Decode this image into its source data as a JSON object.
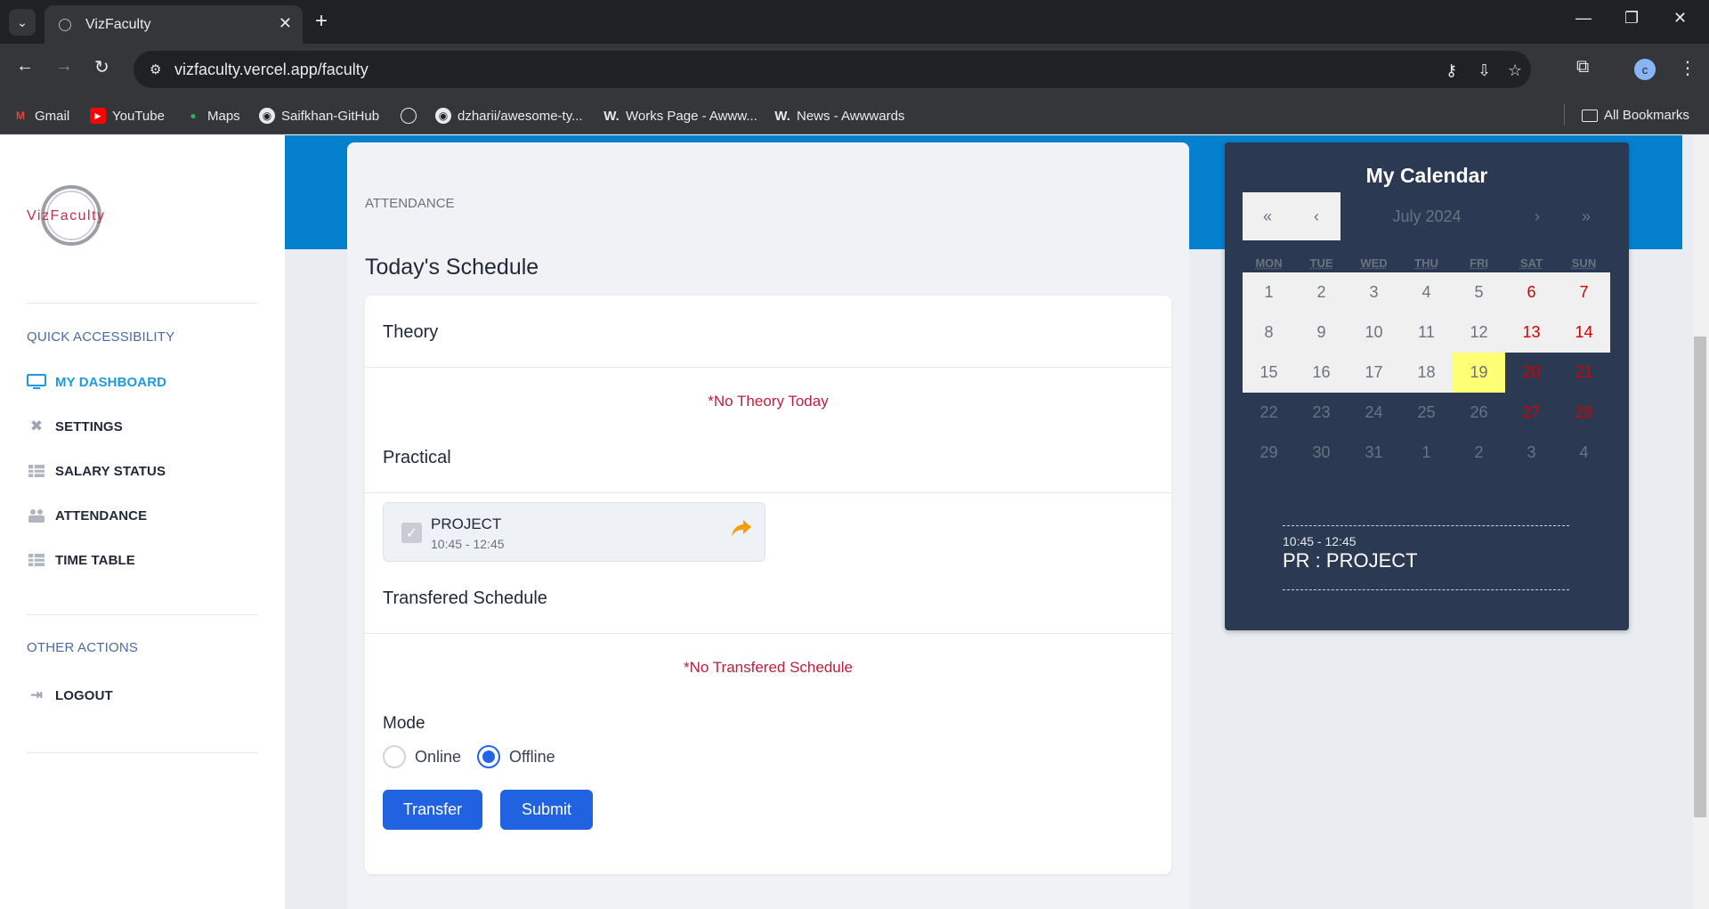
{
  "browser": {
    "tab_title": "VizFaculty",
    "url": "vizfaculty.vercel.app/faculty",
    "bookmarks": [
      {
        "label": "Gmail",
        "icon": "gmail-icon"
      },
      {
        "label": "YouTube",
        "icon": "youtube-icon"
      },
      {
        "label": "Maps",
        "icon": "maps-icon"
      },
      {
        "label": "Saifkhan-GitHub",
        "icon": "github-icon"
      },
      {
        "label": "",
        "icon": "globe-icon"
      },
      {
        "label": "dzharii/awesome-ty...",
        "icon": "github-icon"
      },
      {
        "label": "Works Page - Awww...",
        "icon": "awwwards-icon"
      },
      {
        "label": "News - Awwwards",
        "icon": "awwwards-icon"
      }
    ],
    "all_bookmarks": "All Bookmarks",
    "avatar_letter": "c"
  },
  "sidebar": {
    "logo_text": "VizFaculty",
    "quick_title": "QUICK ACCESSIBILITY",
    "items": [
      {
        "label": "MY DASHBOARD",
        "icon": "monitor-icon",
        "active": true
      },
      {
        "label": "SETTINGS",
        "icon": "tools-icon"
      },
      {
        "label": "SALARY STATUS",
        "icon": "table-icon"
      },
      {
        "label": "ATTENDANCE",
        "icon": "people-icon"
      },
      {
        "label": "TIME TABLE",
        "icon": "table-icon"
      }
    ],
    "other_title": "OTHER ACTIONS",
    "logout": "LOGOUT"
  },
  "main": {
    "label": "ATTENDANCE",
    "heading": "Today's Schedule",
    "theory_title": "Theory",
    "no_theory": "*No Theory Today",
    "practical_title": "Practical",
    "practical_items": [
      {
        "name": "PROJECT",
        "time": "10:45 - 12:45"
      }
    ],
    "transfered_title": "Transfered Schedule",
    "no_transfered": "*No Transfered Schedule",
    "mode_label": "Mode",
    "mode_options": [
      "Online",
      "Offline"
    ],
    "mode_selected": "Offline",
    "transfer_btn": "Transfer",
    "submit_btn": "Submit"
  },
  "calendar": {
    "title": "My Calendar",
    "month": "July 2024",
    "nav": [
      "«",
      "‹",
      "›",
      "»"
    ],
    "weekdays": [
      "MON",
      "TUE",
      "WED",
      "THU",
      "FRI",
      "SAT",
      "SUN"
    ],
    "weeks": [
      [
        "1",
        "2",
        "3",
        "4",
        "5",
        "6",
        "7"
      ],
      [
        "8",
        "9",
        "10",
        "11",
        "12",
        "13",
        "14"
      ],
      [
        "15",
        "16",
        "17",
        "18",
        "19",
        "20",
        "21"
      ],
      [
        "22",
        "23",
        "24",
        "25",
        "26",
        "27",
        "28"
      ],
      [
        "29",
        "30",
        "31",
        "1",
        "2",
        "3",
        "4"
      ]
    ],
    "today": "19",
    "event_time": "10:45 - 12:45",
    "event_title": "PR : PROJECT",
    "colors": {
      "weekend": "#d10000",
      "today": "#ffff76",
      "panel": "#2b3a52"
    }
  }
}
